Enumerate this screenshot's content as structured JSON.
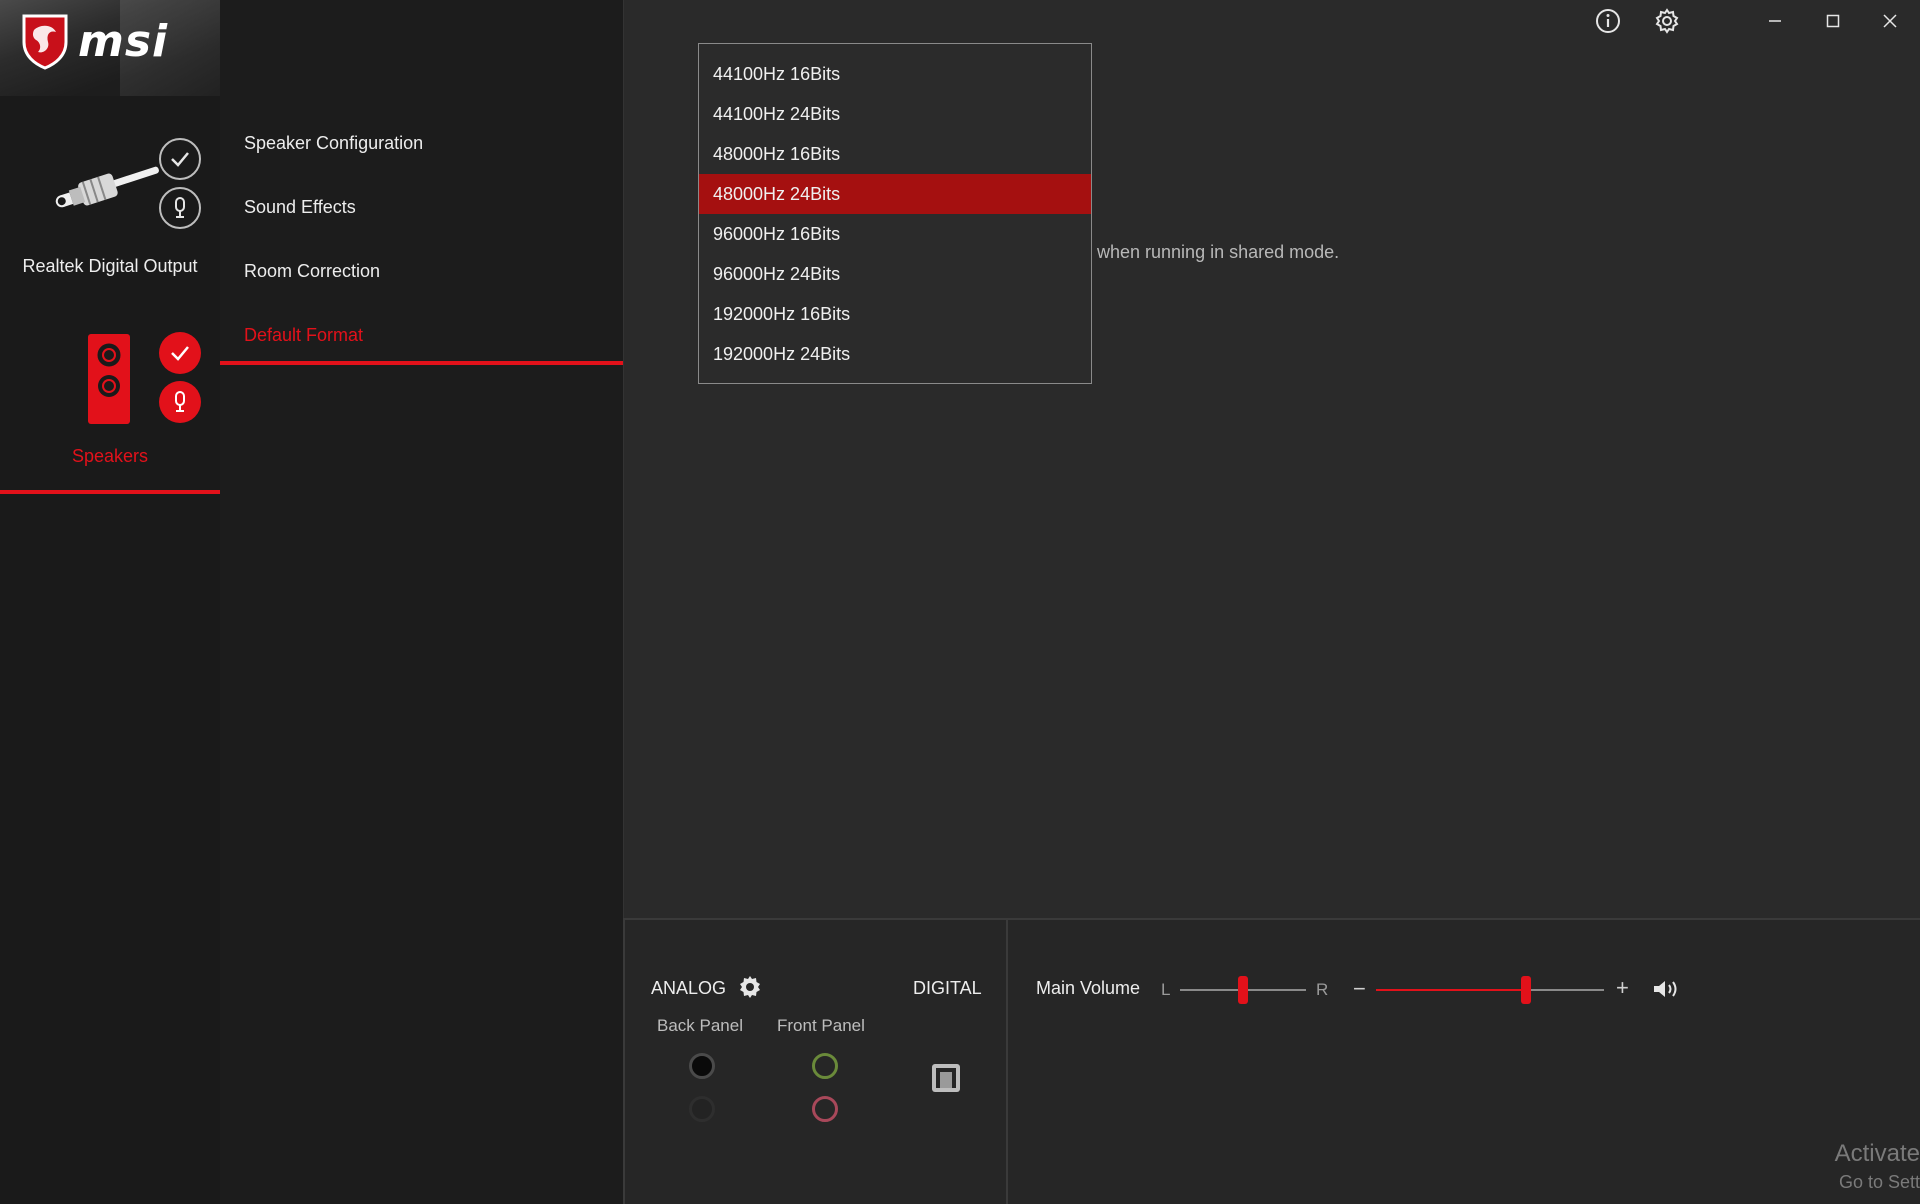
{
  "app": {
    "brand": "msi",
    "colors": {
      "accent": "#e2111a",
      "selected_bg": "#a51010",
      "background": "#2a2a2a"
    }
  },
  "devices": [
    {
      "label": "Realtek Digital Output",
      "icon": "digital-plug-icon",
      "active": false
    },
    {
      "label": "Speakers",
      "icon": "speaker-icon",
      "active": true
    }
  ],
  "nav": {
    "items": [
      {
        "label": "Speaker Configuration",
        "active": false
      },
      {
        "label": "Sound Effects",
        "active": false
      },
      {
        "label": "Room Correction",
        "active": false
      },
      {
        "label": "Default Format",
        "active": true
      }
    ]
  },
  "main": {
    "description": "when running in shared mode."
  },
  "format_dropdown": {
    "options": [
      "44100Hz 16Bits",
      "44100Hz 24Bits",
      "48000Hz 16Bits",
      "48000Hz 24Bits",
      "96000Hz 16Bits",
      "96000Hz 24Bits",
      "192000Hz 16Bits",
      "192000Hz 24Bits"
    ],
    "selected": "48000Hz 24Bits"
  },
  "jacks": {
    "analog_label": "ANALOG",
    "digital_label": "DIGITAL",
    "back_panel_label": "Back Panel",
    "front_panel_label": "Front Panel",
    "back_panel_colors": [
      "#111111",
      "#2e2e2e"
    ],
    "front_panel_colors": [
      "#6a8a3a",
      "#a8485a"
    ]
  },
  "volume": {
    "label": "Main Volume",
    "balance_left": "L",
    "balance_right": "R",
    "balance_value": 0.5,
    "minus": "−",
    "plus": "+",
    "level": 0.66
  },
  "watermark": {
    "line1": "Activate",
    "line2": "Go to Sett"
  }
}
